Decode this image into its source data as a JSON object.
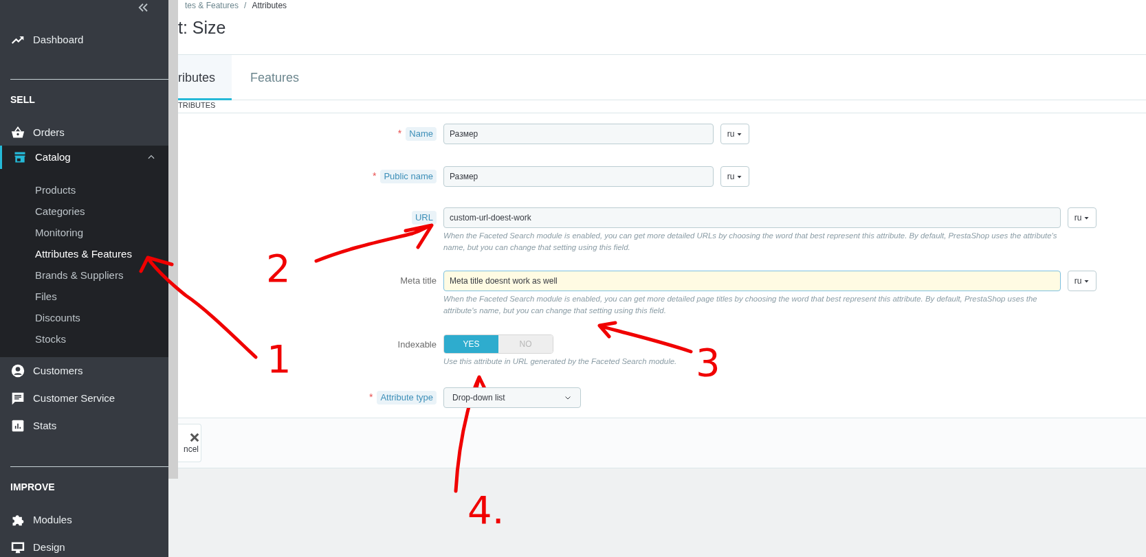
{
  "sidebar": {
    "sections": [
      {
        "items": [
          {
            "label": "Dashboard",
            "selected": false
          }
        ]
      },
      {
        "heading": "SELL",
        "items": [
          {
            "label": "Orders",
            "selected": false
          },
          {
            "label": "Catalog",
            "selected": true,
            "expanded": true,
            "children": [
              {
                "label": "Products",
                "selected": false
              },
              {
                "label": "Categories",
                "selected": false
              },
              {
                "label": "Monitoring",
                "selected": false
              },
              {
                "label": "Attributes & Features",
                "selected": true
              },
              {
                "label": "Brands & Suppliers",
                "selected": false
              },
              {
                "label": "Files",
                "selected": false
              },
              {
                "label": "Discounts",
                "selected": false
              },
              {
                "label": "Stocks",
                "selected": false
              }
            ]
          },
          {
            "label": "Customers",
            "selected": false
          },
          {
            "label": "Customer Service",
            "selected": false
          },
          {
            "label": "Stats",
            "selected": false
          }
        ]
      },
      {
        "heading": "IMPROVE",
        "items": [
          {
            "label": "Modules",
            "selected": false
          },
          {
            "label": "Design",
            "selected": false
          }
        ]
      }
    ]
  },
  "breadcrumb": {
    "items": [
      "tes & Features",
      "Attributes"
    ],
    "separator": "/"
  },
  "page_title": "t: Size",
  "tabs": [
    {
      "label": "ributes",
      "selected": true
    },
    {
      "label": "Features",
      "selected": false
    }
  ],
  "card_heading": "TRIBUTES",
  "form": {
    "required_mark": "*",
    "rows": [
      {
        "kind": "text",
        "label": "Name",
        "required": true,
        "hint": true,
        "value": "Размер",
        "lang": "ru",
        "wide": false,
        "focused": false
      },
      {
        "kind": "text",
        "label": "Public name",
        "required": true,
        "hint": true,
        "value": "Размер",
        "lang": "ru",
        "wide": false,
        "focused": false
      },
      {
        "kind": "text",
        "label": "URL",
        "required": false,
        "hint": true,
        "value": "custom-url-doest-work",
        "lang": "ru",
        "wide": true,
        "focused": false,
        "help": "When the Faceted Search module is enabled, you can get more detailed URLs by choosing the word that best represent this attribute. By default, PrestaShop uses the attribute's name, but you can change that setting using this field."
      },
      {
        "kind": "text",
        "label": "Meta title",
        "required": false,
        "hint": false,
        "value": "Meta title doesnt work as well",
        "lang": "ru",
        "wide": true,
        "focused": true,
        "help": "When the Faceted Search module is enabled, you can get more detailed page titles by choosing the word that best represent this attribute. By default, PrestaShop uses the attribute's name, but you can change that setting using this field."
      },
      {
        "kind": "toggle",
        "label": "Indexable",
        "required": false,
        "hint": false,
        "options": [
          {
            "label": "YES",
            "selected": true
          },
          {
            "label": "NO",
            "selected": false
          }
        ],
        "help": "Use this attribute in URL generated by the Faceted Search module."
      },
      {
        "kind": "select",
        "label": "Attribute type",
        "required": true,
        "hint": true,
        "value": "Drop-down list"
      }
    ]
  },
  "footer": {
    "cancel_label": "ncel"
  },
  "annotations": [
    {
      "label": "1"
    },
    {
      "label": "2"
    },
    {
      "label": "3"
    },
    {
      "label": "4."
    }
  ]
}
